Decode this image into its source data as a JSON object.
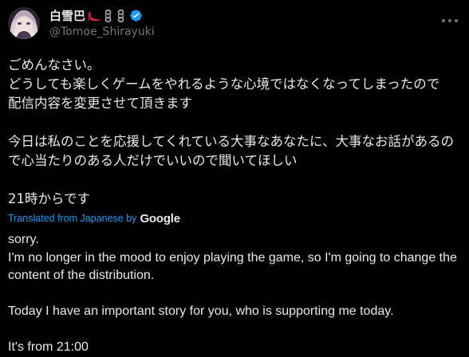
{
  "tweet": {
    "display_name": "白雪巴",
    "handle": "@Tomoe_Shirayuki",
    "text_ja": "ごめんなさい。\nどうしても楽しくゲームをやれるような心境ではなくなってしまったので\n配信内容を変更させて頂きます\n\n今日は私のことを応援してくれている大事なあなたに、大事なお話があるので心当たりのある人だけでいいので聞いてほしい\n\n21時からです",
    "translated_label": "Translated from Japanese by",
    "translator": "Google",
    "text_en": "sorry.\nI'm no longer in the mood to enjoy playing the game, so I'm going to change the content of the distribution.\n\nToday I have an important story for you, who is supporting me today.\n\nIt's from 21:00"
  },
  "icons": {
    "name_emoji_1": "high-heel-icon",
    "name_emoji_2": "chain-icon",
    "verified": "verified-badge-icon",
    "more": "more-options-icon"
  },
  "colors": {
    "background": "#000000",
    "text": "#e7e9ea",
    "secondary": "#71767b",
    "accent": "#1d9bf0"
  }
}
